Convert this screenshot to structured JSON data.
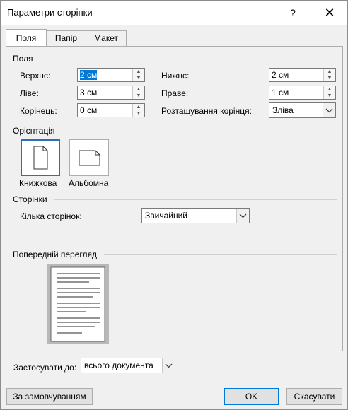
{
  "window": {
    "title": "Параметри сторінки"
  },
  "titlebar": {
    "help": "?",
    "close": "✕"
  },
  "tabs": [
    {
      "label": "Поля"
    },
    {
      "label": "Папір"
    },
    {
      "label": "Макет"
    }
  ],
  "margins": {
    "section": "Поля",
    "top_label": "Верхнє:",
    "top_value": "2 см",
    "bottom_label": "Нижнє:",
    "bottom_value": "2 см",
    "left_label": "Ліве:",
    "left_value": "3 см",
    "right_label": "Праве:",
    "right_value": "1 см",
    "gutter_label": "Корінець:",
    "gutter_value": "0 см",
    "gutter_pos_label": "Розташування корінця:",
    "gutter_pos_value": "Зліва"
  },
  "orientation": {
    "section": "Орієнтація",
    "portrait": "Книжкова",
    "landscape": "Альбомна"
  },
  "pages": {
    "section": "Сторінки",
    "multiple_label": "Кілька сторінок:",
    "multiple_value": "Звичайний"
  },
  "preview": {
    "section": "Попередній перегляд"
  },
  "apply": {
    "label": "Застосувати до:",
    "value": "всього документа"
  },
  "footer": {
    "default_button": "За замовчуванням",
    "ok": "OK",
    "cancel": "Скасувати"
  },
  "colors": {
    "accent": "#0078d7",
    "selected_border": "#2f6db5"
  },
  "icons": {
    "spin_up": "▲",
    "spin_down": "▼",
    "dropdown": "chevron-down"
  }
}
